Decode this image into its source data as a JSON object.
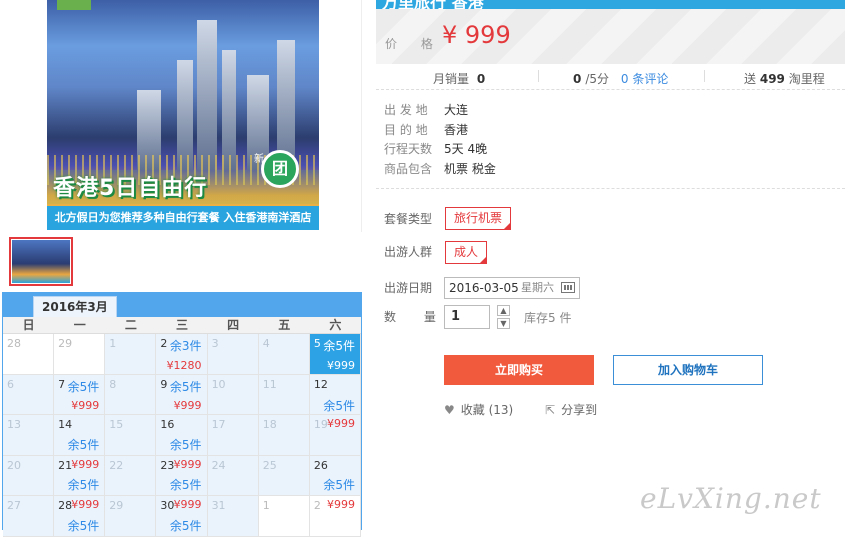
{
  "product": {
    "title_fragment": "万里旅行 香港",
    "image": {
      "headline": "香港5日自由行",
      "badge": "团",
      "badge_small": "新",
      "strip_text": "北方假日为您推荐多种自由行套餐 入住香港南洋酒店"
    },
    "price_label": "价 格",
    "price_value": "¥ 999",
    "stats": {
      "monthly_sales_label": "月销量",
      "monthly_sales_value": "0",
      "rating_value": "0",
      "rating_suffix": "/5分",
      "reviews": "0 条评论",
      "points_prefix": "送",
      "points_value": "499",
      "points_suffix": "淘里程"
    },
    "attributes": [
      {
        "label": "出 发 地",
        "value": "大连"
      },
      {
        "label": "目 的 地",
        "value": "香港"
      },
      {
        "label": "行程天数",
        "value": "5天 4晚"
      },
      {
        "label": "商品包含",
        "value": "机票 税金"
      }
    ],
    "package_type_label": "套餐类型",
    "package_type_value": "旅行机票",
    "travelers_label": "出游人群",
    "travelers_value": "成人",
    "date_label": "出游日期",
    "date_value": "2016-03-05",
    "date_weekday": "星期六",
    "qty_label": "数 量",
    "qty_value": "1",
    "stock_text": "库存5 件",
    "buy_label": "立即购买",
    "cart_label": "加入购物车",
    "fav_icon": "heart-icon",
    "fav_label": "收藏 (13)",
    "share_icon": "share-icon",
    "share_label": "分享到"
  },
  "calendar": {
    "month_label": "2016年3月",
    "weekdays": [
      "日",
      "一",
      "二",
      "三",
      "四",
      "五",
      "六"
    ],
    "days": [
      {
        "num": "28",
        "kind": "other"
      },
      {
        "num": "29",
        "kind": "other"
      },
      {
        "num": "1",
        "kind": "dim"
      },
      {
        "num": "2",
        "kind": "avail",
        "stock": "余3件",
        "price": "¥1280",
        "layout": "stock-top"
      },
      {
        "num": "3",
        "kind": "dim"
      },
      {
        "num": "4",
        "kind": "dim"
      },
      {
        "num": "5",
        "kind": "sel",
        "stock": "余5件",
        "price": "¥999",
        "layout": "stock-top"
      },
      {
        "num": "6",
        "kind": "dim"
      },
      {
        "num": "7",
        "kind": "avail",
        "stock": "余5件",
        "price": "¥999",
        "layout": "stock-top"
      },
      {
        "num": "8",
        "kind": "dim"
      },
      {
        "num": "9",
        "kind": "avail",
        "stock": "余5件",
        "price": "¥999",
        "layout": "stock-top"
      },
      {
        "num": "10",
        "kind": "dim"
      },
      {
        "num": "11",
        "kind": "dim"
      },
      {
        "num": "12",
        "kind": "avail",
        "stock": "余5件",
        "layout": "stock-mid"
      },
      {
        "num": "13",
        "kind": "dim"
      },
      {
        "num": "14",
        "kind": "avail",
        "stock": "余5件",
        "layout": "stock-bot"
      },
      {
        "num": "15",
        "kind": "dim"
      },
      {
        "num": "16",
        "kind": "avail",
        "stock": "余5件",
        "layout": "stock-bot"
      },
      {
        "num": "17",
        "kind": "dim"
      },
      {
        "num": "18",
        "kind": "dim"
      },
      {
        "num": "19",
        "kind": "dim",
        "price": "¥999",
        "layout": "price-top"
      },
      {
        "num": "20",
        "kind": "dim"
      },
      {
        "num": "21",
        "kind": "avail",
        "stock": "余5件",
        "price": "¥999",
        "layout": "price-top"
      },
      {
        "num": "22",
        "kind": "dim"
      },
      {
        "num": "23",
        "kind": "avail",
        "stock": "余5件",
        "price": "¥999",
        "layout": "price-top"
      },
      {
        "num": "24",
        "kind": "dim"
      },
      {
        "num": "25",
        "kind": "dim"
      },
      {
        "num": "26",
        "kind": "avail",
        "stock": "余5件",
        "layout": "stock-bot"
      },
      {
        "num": "27",
        "kind": "dim"
      },
      {
        "num": "28",
        "kind": "avail",
        "stock": "余5件",
        "price": "¥999",
        "layout": "price-top"
      },
      {
        "num": "29",
        "kind": "dim"
      },
      {
        "num": "30",
        "kind": "avail",
        "stock": "余5件",
        "price": "¥999",
        "layout": "price-top"
      },
      {
        "num": "31",
        "kind": "dim"
      },
      {
        "num": "1",
        "kind": "other"
      },
      {
        "num": "2",
        "kind": "other",
        "price": "¥999",
        "layout": "price-top"
      }
    ]
  },
  "watermark": "eLvXing.net"
}
